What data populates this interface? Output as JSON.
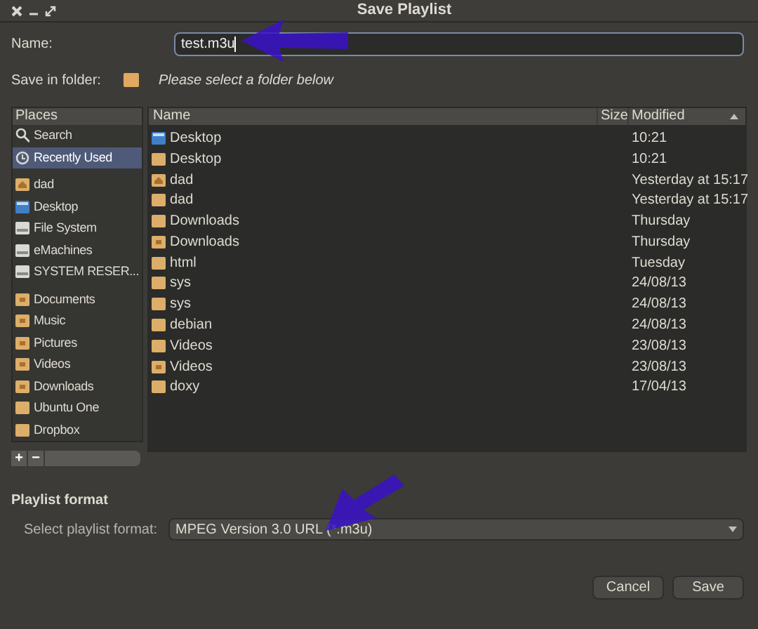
{
  "window": {
    "title": "Save Playlist"
  },
  "name_field": {
    "label": "Name:",
    "value": "test.m3u"
  },
  "save_in_folder": {
    "label": "Save in folder:",
    "hint": "Please select a folder below"
  },
  "places": {
    "header": "Places",
    "groups": [
      {
        "items": [
          {
            "label": "Search",
            "kind": "search",
            "selected": false
          },
          {
            "label": "Recently Used",
            "kind": "recent",
            "selected": true
          }
        ]
      },
      {
        "items": [
          {
            "label": "dad",
            "kind": "home",
            "selected": false
          },
          {
            "label": "Desktop",
            "kind": "desktop",
            "selected": false
          },
          {
            "label": "File System",
            "kind": "drive",
            "selected": false
          },
          {
            "label": "eMachines",
            "kind": "drive",
            "selected": false
          },
          {
            "label": "SYSTEM RESER...",
            "kind": "drive",
            "selected": false
          }
        ]
      },
      {
        "items": [
          {
            "label": "Documents",
            "kind": "special",
            "selected": false
          },
          {
            "label": "Music",
            "kind": "special",
            "selected": false
          },
          {
            "label": "Pictures",
            "kind": "special",
            "selected": false
          },
          {
            "label": "Videos",
            "kind": "special",
            "selected": false
          },
          {
            "label": "Downloads",
            "kind": "special",
            "selected": false
          },
          {
            "label": "Ubuntu One",
            "kind": "folder",
            "selected": false
          },
          {
            "label": "Dropbox",
            "kind": "folder",
            "selected": false
          }
        ]
      }
    ],
    "add_button": "+",
    "remove_button": "−"
  },
  "files": {
    "columns": [
      "Name",
      "Size",
      "Modified"
    ],
    "rows": [
      {
        "name": "Desktop",
        "kind": "desktop",
        "modified": "10:21"
      },
      {
        "name": "Desktop",
        "kind": "folder",
        "modified": "10:21"
      },
      {
        "name": "dad",
        "kind": "home",
        "modified": "Yesterday at 15:17"
      },
      {
        "name": "dad",
        "kind": "folder",
        "modified": "Yesterday at 15:17"
      },
      {
        "name": "Downloads",
        "kind": "folder",
        "modified": "Thursday"
      },
      {
        "name": "Downloads",
        "kind": "special",
        "modified": "Thursday"
      },
      {
        "name": "html",
        "kind": "folder",
        "modified": "Tuesday"
      },
      {
        "name": "sys",
        "kind": "folder",
        "modified": "24/08/13"
      },
      {
        "name": "sys",
        "kind": "folder",
        "modified": "24/08/13"
      },
      {
        "name": "debian",
        "kind": "folder",
        "modified": "24/08/13"
      },
      {
        "name": "Videos",
        "kind": "folder",
        "modified": "23/08/13"
      },
      {
        "name": "Videos",
        "kind": "special",
        "modified": "23/08/13"
      },
      {
        "name": "doxy",
        "kind": "folder",
        "modified": "17/04/13"
      }
    ]
  },
  "playlist_format": {
    "heading": "Playlist format",
    "label": "Select playlist format:",
    "value": "MPEG Version 3.0 URL (*.m3u)"
  },
  "buttons": [
    "Cancel",
    "Save"
  ]
}
